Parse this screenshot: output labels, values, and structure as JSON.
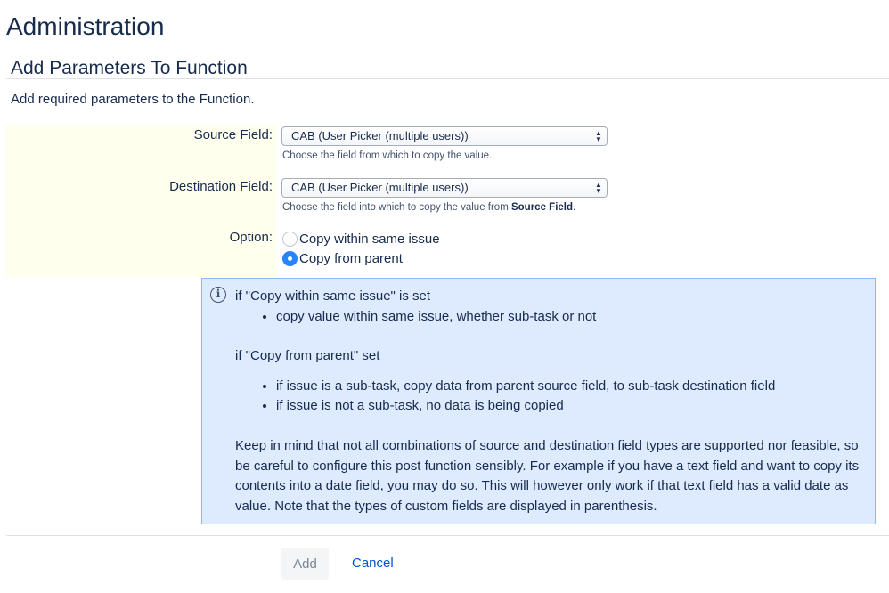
{
  "page": {
    "title": "Administration"
  },
  "section": {
    "title": "Add Parameters To Function",
    "intro": "Add required parameters to the Function."
  },
  "form": {
    "source_field": {
      "label": "Source Field:",
      "value": "CAB (User Picker (multiple users))",
      "help": "Choose the field from which to copy the value."
    },
    "destination_field": {
      "label": "Destination Field:",
      "value": "CAB (User Picker (multiple users))",
      "help_prefix": "Choose the field into which to copy the value from ",
      "help_bold": "Source Field",
      "help_suffix": "."
    },
    "option": {
      "label": "Option:",
      "choices": [
        {
          "label": "Copy within same issue",
          "checked": false
        },
        {
          "label": "Copy from parent",
          "checked": true
        }
      ]
    }
  },
  "info": {
    "icon": "info-icon",
    "same_issue_heading": "if \"Copy within same issue\" is set",
    "same_issue_bullets": [
      "copy value within same issue, whether sub-task or not"
    ],
    "parent_heading": "if \"Copy from parent\" set",
    "parent_bullets": [
      "if issue is a sub-task, copy data from parent source field, to sub-task destination field",
      "if issue is not a sub-task, no data is being copied"
    ],
    "note": "Keep in mind that not all combinations of source and destination field types are supported nor feasible, so be careful to configure this post function sensibly. For example if you have a text field and want to copy its contents into a date field, you may do so. This will however only work if that text field has a valid date as value. Note that the types of custom fields are displayed in parenthesis."
  },
  "actions": {
    "add_label": "Add",
    "cancel_label": "Cancel"
  },
  "colors": {
    "accent": "#2684ff",
    "info_background": "#deebff",
    "field_band": "#ffffee",
    "link": "#0052cc"
  }
}
